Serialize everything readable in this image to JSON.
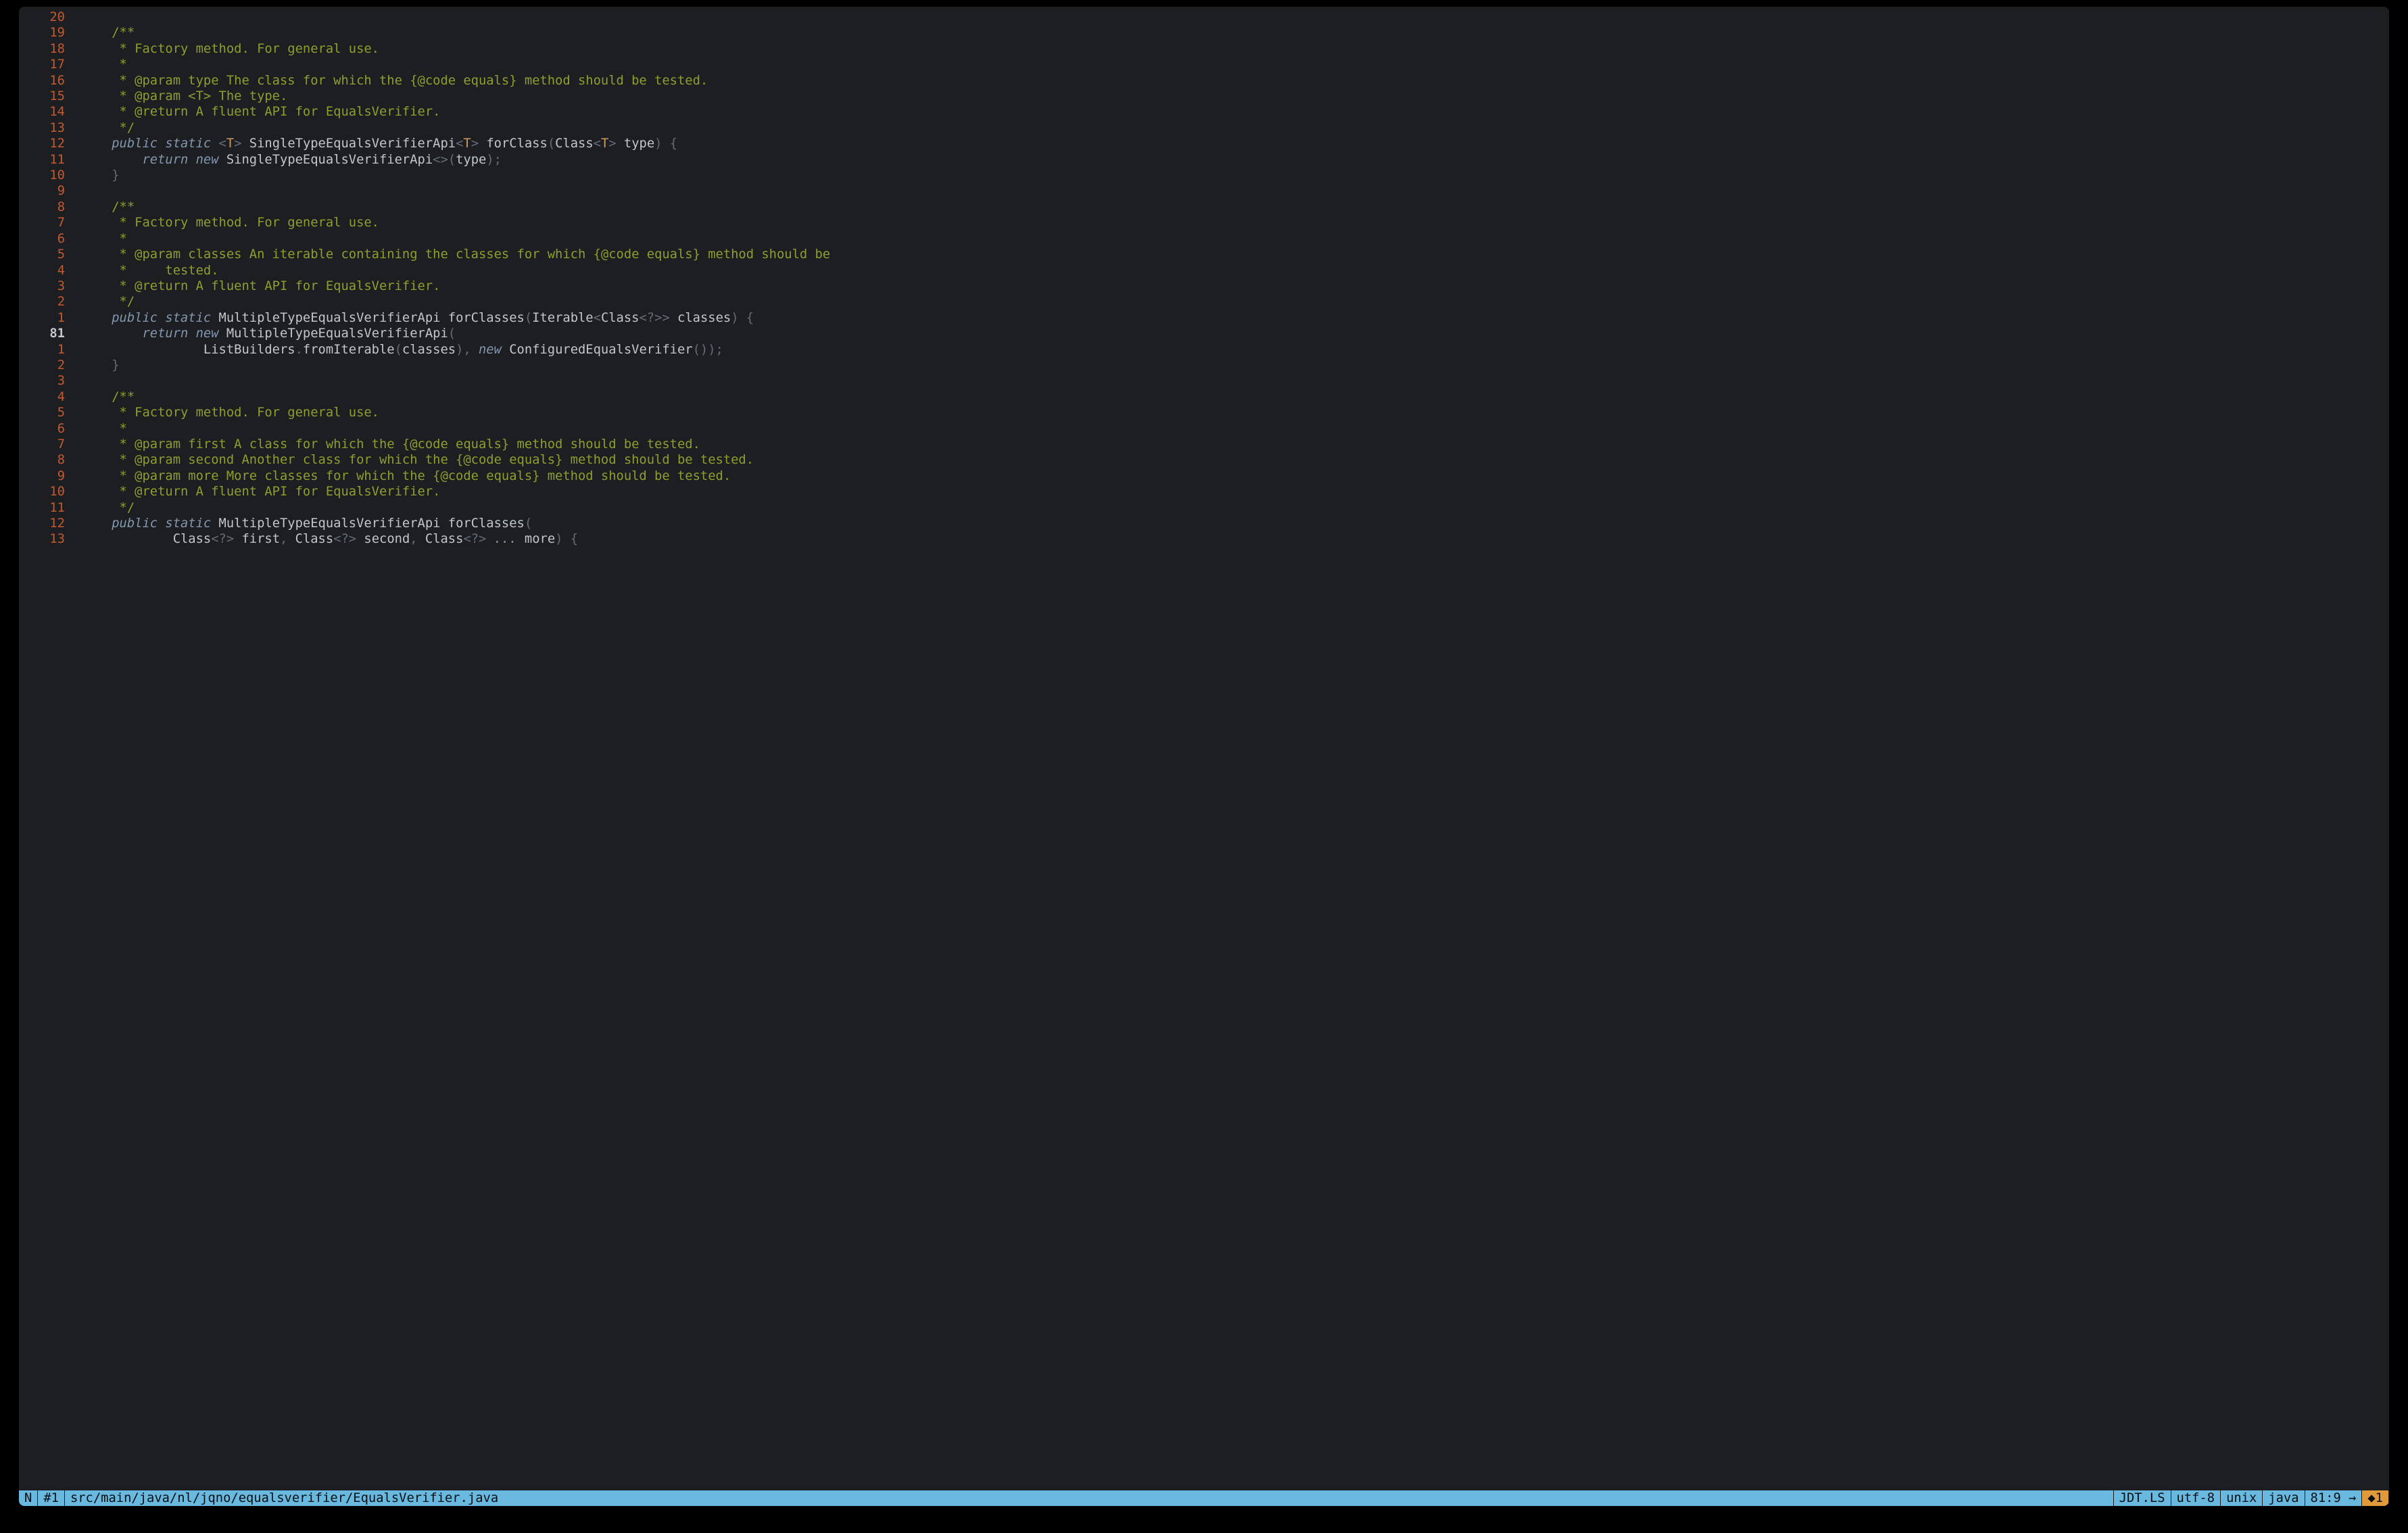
{
  "editor": {
    "current_line_abs": "81",
    "lines": [
      {
        "rel": "20",
        "cur": false,
        "segments": []
      },
      {
        "rel": "19",
        "cur": false,
        "segments": [
          {
            "cls": "c",
            "t": "/**"
          }
        ],
        "indent": 4
      },
      {
        "rel": "18",
        "cur": false,
        "segments": [
          {
            "cls": "c",
            "t": " * Factory method. For general use."
          }
        ],
        "indent": 4
      },
      {
        "rel": "17",
        "cur": false,
        "segments": [
          {
            "cls": "c",
            "t": " *"
          }
        ],
        "indent": 4
      },
      {
        "rel": "16",
        "cur": false,
        "segments": [
          {
            "cls": "c",
            "t": " * @param type The class for which the {@code equals} method should be tested."
          }
        ],
        "indent": 4
      },
      {
        "rel": "15",
        "cur": false,
        "segments": [
          {
            "cls": "c",
            "t": " * @param <T> The type."
          }
        ],
        "indent": 4
      },
      {
        "rel": "14",
        "cur": false,
        "segments": [
          {
            "cls": "c",
            "t": " * @return A fluent API for EqualsVerifier."
          }
        ],
        "indent": 4
      },
      {
        "rel": "13",
        "cur": false,
        "segments": [
          {
            "cls": "c",
            "t": " */"
          }
        ],
        "indent": 4
      },
      {
        "rel": "12",
        "cur": false,
        "segments": [
          {
            "cls": "kw",
            "t": "public"
          },
          {
            "cls": "pn",
            "t": " "
          },
          {
            "cls": "kw",
            "t": "static"
          },
          {
            "cls": "pn",
            "t": " "
          },
          {
            "cls": "pn",
            "t": "<"
          },
          {
            "cls": "tp",
            "t": "T"
          },
          {
            "cls": "pn",
            "t": "> "
          },
          {
            "cls": "ty",
            "t": "SingleTypeEqualsVerifierApi"
          },
          {
            "cls": "pn",
            "t": "<"
          },
          {
            "cls": "tp",
            "t": "T"
          },
          {
            "cls": "pn",
            "t": "> "
          },
          {
            "cls": "fn",
            "t": "forClass"
          },
          {
            "cls": "pn",
            "t": "("
          },
          {
            "cls": "ty",
            "t": "Class"
          },
          {
            "cls": "pn",
            "t": "<"
          },
          {
            "cls": "tp",
            "t": "T"
          },
          {
            "cls": "pn",
            "t": "> "
          },
          {
            "cls": "id",
            "t": "type"
          },
          {
            "cls": "pn",
            "t": ") {"
          }
        ],
        "indent": 4
      },
      {
        "rel": "11",
        "cur": false,
        "segments": [
          {
            "cls": "kw",
            "t": "return"
          },
          {
            "cls": "pn",
            "t": " "
          },
          {
            "cls": "kw",
            "t": "new"
          },
          {
            "cls": "pn",
            "t": " "
          },
          {
            "cls": "ty",
            "t": "SingleTypeEqualsVerifierApi"
          },
          {
            "cls": "pn",
            "t": "<>("
          },
          {
            "cls": "id",
            "t": "type"
          },
          {
            "cls": "pn",
            "t": ");"
          }
        ],
        "indent": 8
      },
      {
        "rel": "10",
        "cur": false,
        "segments": [
          {
            "cls": "pn",
            "t": "}"
          }
        ],
        "indent": 4
      },
      {
        "rel": "9",
        "cur": false,
        "segments": []
      },
      {
        "rel": "8",
        "cur": false,
        "segments": [
          {
            "cls": "c",
            "t": "/**"
          }
        ],
        "indent": 4
      },
      {
        "rel": "7",
        "cur": false,
        "segments": [
          {
            "cls": "c",
            "t": " * Factory method. For general use."
          }
        ],
        "indent": 4
      },
      {
        "rel": "6",
        "cur": false,
        "segments": [
          {
            "cls": "c",
            "t": " *"
          }
        ],
        "indent": 4
      },
      {
        "rel": "5",
        "cur": false,
        "segments": [
          {
            "cls": "c",
            "t": " * @param classes An iterable containing the classes for which {@code equals} method should be"
          }
        ],
        "indent": 4
      },
      {
        "rel": "4",
        "cur": false,
        "segments": [
          {
            "cls": "c",
            "t": " *     tested."
          }
        ],
        "indent": 4
      },
      {
        "rel": "3",
        "cur": false,
        "segments": [
          {
            "cls": "c",
            "t": " * @return A fluent API for EqualsVerifier."
          }
        ],
        "indent": 4
      },
      {
        "rel": "2",
        "cur": false,
        "segments": [
          {
            "cls": "c",
            "t": " */"
          }
        ],
        "indent": 4
      },
      {
        "rel": "1",
        "cur": false,
        "segments": [
          {
            "cls": "kw",
            "t": "public"
          },
          {
            "cls": "pn",
            "t": " "
          },
          {
            "cls": "kw",
            "t": "static"
          },
          {
            "cls": "pn",
            "t": " "
          },
          {
            "cls": "ty",
            "t": "MultipleTypeEqualsVerifierApi "
          },
          {
            "cls": "fn",
            "t": "forClasses"
          },
          {
            "cls": "pn",
            "t": "("
          },
          {
            "cls": "ty",
            "t": "Iterable"
          },
          {
            "cls": "pn",
            "t": "<"
          },
          {
            "cls": "ty",
            "t": "Class"
          },
          {
            "cls": "pn",
            "t": "<?>> "
          },
          {
            "cls": "id",
            "t": "classes"
          },
          {
            "cls": "pn",
            "t": ") {"
          }
        ],
        "indent": 4
      },
      {
        "rel": "81",
        "cur": true,
        "segments": [
          {
            "cls": "kw",
            "t": "return"
          },
          {
            "cls": "pn",
            "t": " "
          },
          {
            "cls": "kw",
            "t": "new"
          },
          {
            "cls": "pn",
            "t": " "
          },
          {
            "cls": "ty",
            "t": "MultipleTypeEqualsVerifierApi"
          },
          {
            "cls": "pn",
            "t": "("
          }
        ],
        "indent": 8
      },
      {
        "rel": "1",
        "cur": false,
        "segments": [
          {
            "cls": "ty",
            "t": "ListBuilders"
          },
          {
            "cls": "pn",
            "t": "."
          },
          {
            "cls": "mth",
            "t": "fromIterable"
          },
          {
            "cls": "pn",
            "t": "("
          },
          {
            "cls": "id",
            "t": "classes"
          },
          {
            "cls": "pn",
            "t": "), "
          },
          {
            "cls": "kw",
            "t": "new"
          },
          {
            "cls": "pn",
            "t": " "
          },
          {
            "cls": "ty",
            "t": "ConfiguredEqualsVerifier"
          },
          {
            "cls": "pn",
            "t": "());"
          }
        ],
        "indent": 16
      },
      {
        "rel": "2",
        "cur": false,
        "segments": [
          {
            "cls": "pn",
            "t": "}"
          }
        ],
        "indent": 4
      },
      {
        "rel": "3",
        "cur": false,
        "segments": []
      },
      {
        "rel": "4",
        "cur": false,
        "segments": [
          {
            "cls": "c",
            "t": "/**"
          }
        ],
        "indent": 4
      },
      {
        "rel": "5",
        "cur": false,
        "segments": [
          {
            "cls": "c",
            "t": " * Factory method. For general use."
          }
        ],
        "indent": 4
      },
      {
        "rel": "6",
        "cur": false,
        "segments": [
          {
            "cls": "c",
            "t": " *"
          }
        ],
        "indent": 4
      },
      {
        "rel": "7",
        "cur": false,
        "segments": [
          {
            "cls": "c",
            "t": " * @param first A class for which the {@code equals} method should be tested."
          }
        ],
        "indent": 4
      },
      {
        "rel": "8",
        "cur": false,
        "segments": [
          {
            "cls": "c",
            "t": " * @param second Another class for which the {@code equals} method should be tested."
          }
        ],
        "indent": 4
      },
      {
        "rel": "9",
        "cur": false,
        "segments": [
          {
            "cls": "c",
            "t": " * @param more More classes for which the {@code equals} method should be tested."
          }
        ],
        "indent": 4
      },
      {
        "rel": "10",
        "cur": false,
        "segments": [
          {
            "cls": "c",
            "t": " * @return A fluent API for EqualsVerifier."
          }
        ],
        "indent": 4
      },
      {
        "rel": "11",
        "cur": false,
        "segments": [
          {
            "cls": "c",
            "t": " */"
          }
        ],
        "indent": 4
      },
      {
        "rel": "12",
        "cur": false,
        "segments": [
          {
            "cls": "kw",
            "t": "public"
          },
          {
            "cls": "pn",
            "t": " "
          },
          {
            "cls": "kw",
            "t": "static"
          },
          {
            "cls": "pn",
            "t": " "
          },
          {
            "cls": "ty",
            "t": "MultipleTypeEqualsVerifierApi "
          },
          {
            "cls": "fn",
            "t": "forClasses"
          },
          {
            "cls": "pn",
            "t": "("
          }
        ],
        "indent": 4
      },
      {
        "rel": "13",
        "cur": false,
        "segments": [
          {
            "cls": "ty",
            "t": "Class"
          },
          {
            "cls": "pn",
            "t": "<?> "
          },
          {
            "cls": "id",
            "t": "first"
          },
          {
            "cls": "pn",
            "t": ", "
          },
          {
            "cls": "ty",
            "t": "Class"
          },
          {
            "cls": "pn",
            "t": "<?> "
          },
          {
            "cls": "id",
            "t": "second"
          },
          {
            "cls": "pn",
            "t": ", "
          },
          {
            "cls": "ty",
            "t": "Class"
          },
          {
            "cls": "pn",
            "t": "<?>"
          },
          {
            "cls": "kw",
            "t": " ... "
          },
          {
            "cls": "id",
            "t": "more"
          },
          {
            "cls": "pn",
            "t": ") {"
          }
        ],
        "indent": 12
      }
    ]
  },
  "statusbar": {
    "mode": "N",
    "bufnum": "#1",
    "filepath": "src/main/java/nl/jqno/equalsverifier/EqualsVerifier.java",
    "lsp": "JDT.LS",
    "encoding": "utf-8",
    "fileformat": "unix",
    "filetype": "java",
    "position": "81:9 →",
    "right_indicator": "◆1"
  }
}
